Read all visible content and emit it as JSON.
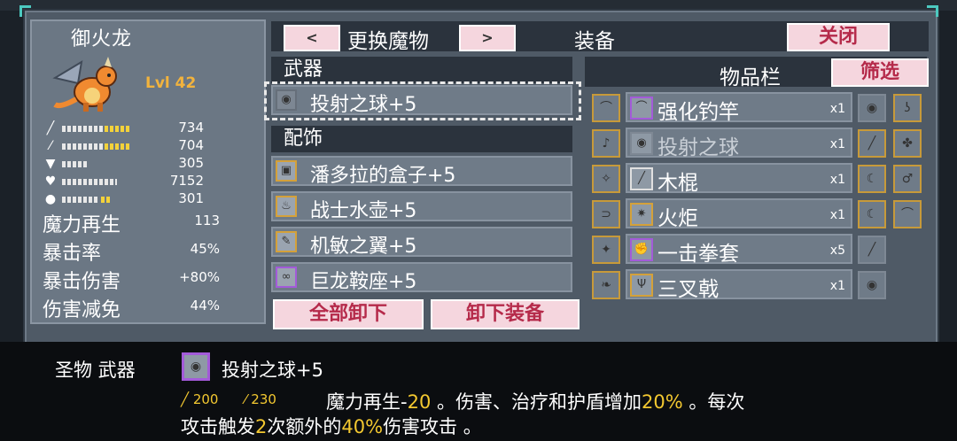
{
  "monster": {
    "name": "御火龙",
    "level": "Lvl 42",
    "stats": [
      {
        "icon": "sword-icon",
        "value": "734"
      },
      {
        "icon": "wand-icon",
        "value": "704"
      },
      {
        "icon": "shield-icon",
        "value": "305"
      },
      {
        "icon": "heart-icon",
        "value": "7152"
      },
      {
        "icon": "mana-flask-icon",
        "value": "301"
      }
    ],
    "text_stats": [
      {
        "label": "魔力再生",
        "value": "113"
      },
      {
        "label": "暴击率",
        "value": "45%"
      },
      {
        "label": "暴击伤害",
        "value": "+80%"
      },
      {
        "label": "伤害减免",
        "value": "44%"
      }
    ]
  },
  "header": {
    "prev": "<",
    "title": "更换魔物",
    "next": ">",
    "equip_title": "装备",
    "close": "关闭"
  },
  "weapon": {
    "section": "武器",
    "item": "投射之球+5"
  },
  "accessories": {
    "section": "配饰",
    "items": [
      "潘多拉的盒子+5",
      "战士水壶+5",
      "机敏之翼+5",
      "巨龙鞍座+5"
    ]
  },
  "buttons": {
    "unequip_all": "全部卸下",
    "unequip": "卸下装备"
  },
  "inventory": {
    "title": "物品栏",
    "filter": "筛选",
    "items": [
      {
        "name": "强化钓竿",
        "count": "x1"
      },
      {
        "name": "投射之球",
        "count": "x1"
      },
      {
        "name": "木棍",
        "count": "x1"
      },
      {
        "name": "火炬",
        "count": "x1"
      },
      {
        "name": "一击拳套",
        "count": "x5"
      },
      {
        "name": "三叉戟",
        "count": "x1"
      }
    ]
  },
  "detail": {
    "category": "圣物  武器",
    "name": "投射之球+5",
    "stat1": "200",
    "stat2": "230",
    "desc_line1_a": "魔力再生-",
    "desc_line1_b": "20",
    "desc_line1_c": " 。伤害、治疗和护盾增加",
    "desc_line1_d": "20%",
    "desc_line1_e": " 。每次",
    "desc_line2_a": "攻击触发",
    "desc_line2_b": "2",
    "desc_line2_c": "次额外的",
    "desc_line2_d": "40%",
    "desc_line2_e": "伤害攻击 。"
  },
  "colors": {
    "accent_gold": "#f3c830",
    "button_text": "#b52a4a",
    "rare_border": "#a35bd9"
  }
}
